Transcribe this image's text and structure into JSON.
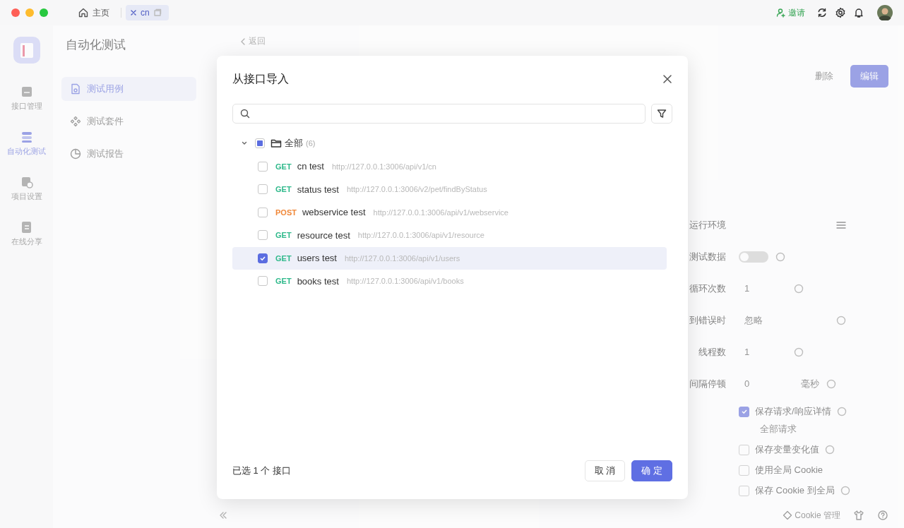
{
  "titlebar": {
    "tabs": [
      {
        "label": "主页",
        "kind": "home",
        "selected": false
      },
      {
        "label": "cn",
        "kind": "doc",
        "selected": true
      }
    ],
    "invite": "邀请"
  },
  "sidebar": {
    "items": [
      {
        "label": "接口管理",
        "kind": "api",
        "selected": false
      },
      {
        "label": "自动化测试",
        "kind": "auto",
        "selected": true
      },
      {
        "label": "项目设置",
        "kind": "settings",
        "selected": false
      },
      {
        "label": "在线分享",
        "kind": "share",
        "selected": false
      }
    ]
  },
  "subnav": {
    "title": "自动化测试",
    "items": [
      {
        "label": "测试用例",
        "kind": "case",
        "selected": true
      },
      {
        "label": "测试套件",
        "kind": "suite",
        "selected": false
      },
      {
        "label": "测试报告",
        "kind": "report",
        "selected": false
      }
    ]
  },
  "main": {
    "back": "返回",
    "buttons": [
      {
        "label": "删除",
        "kind": "text"
      },
      {
        "label": "编辑",
        "kind": "primary"
      }
    ],
    "settings": [
      {
        "label": "运行环境",
        "kind": "select",
        "hint": false
      },
      {
        "label": "测试数据",
        "kind": "toggle",
        "on": false,
        "hint": true
      },
      {
        "label": "循环次数",
        "kind": "number",
        "value": "1",
        "hint": true
      },
      {
        "label": "到错误时",
        "kind": "select",
        "value": "忽略",
        "hint": true
      },
      {
        "label": "线程数",
        "kind": "number",
        "value": "1",
        "hint": true
      },
      {
        "label": "间隔停顿",
        "kind": "number",
        "value": "0",
        "unit": "毫秒",
        "hint": true
      }
    ],
    "options": [
      {
        "label": "保存请求/响应详情",
        "checked": true,
        "hint": true,
        "sub": "全部请求"
      },
      {
        "label": "保存变量变化值",
        "checked": false,
        "hint": true
      },
      {
        "label": "使用全局 Cookie",
        "checked": false,
        "hint": false
      },
      {
        "label": "保存 Cookie 到全局",
        "checked": false,
        "hint": true
      }
    ],
    "cookie": "Cookie 管理"
  },
  "dialog": {
    "title": "从接口导入",
    "tree": {
      "label": "全部",
      "count": "(6)",
      "expanded": true,
      "checked": false,
      "indeterminate": true,
      "children": [
        {
          "method": "GET",
          "name": "cn test",
          "url": "http://127.0.0.1:3006/api/v1/cn",
          "checked": false,
          "selected": false
        },
        {
          "method": "GET",
          "name": "status test",
          "url": "http://127.0.0.1:3006/v2/pet/findByStatus",
          "checked": false,
          "selected": false
        },
        {
          "method": "POST",
          "name": "webservice test",
          "url": "http://127.0.0.1:3006/api/v1/webservice",
          "checked": false,
          "selected": false
        },
        {
          "method": "GET",
          "name": "resource test",
          "url": "http://127.0.0.1:3006/api/v1/resource",
          "checked": false,
          "selected": false
        },
        {
          "method": "GET",
          "name": "users test",
          "url": "http://127.0.0.1:3006/api/v1/users",
          "checked": true,
          "selected": true
        },
        {
          "method": "GET",
          "name": "books test",
          "url": "http://127.0.0.1:3006/api/v1/books",
          "checked": false,
          "selected": false
        }
      ]
    },
    "summary": "已选 1 个 接口",
    "buttons": [
      {
        "label": "取 消",
        "kind": "default"
      },
      {
        "label": "确 定",
        "kind": "primary"
      }
    ]
  }
}
